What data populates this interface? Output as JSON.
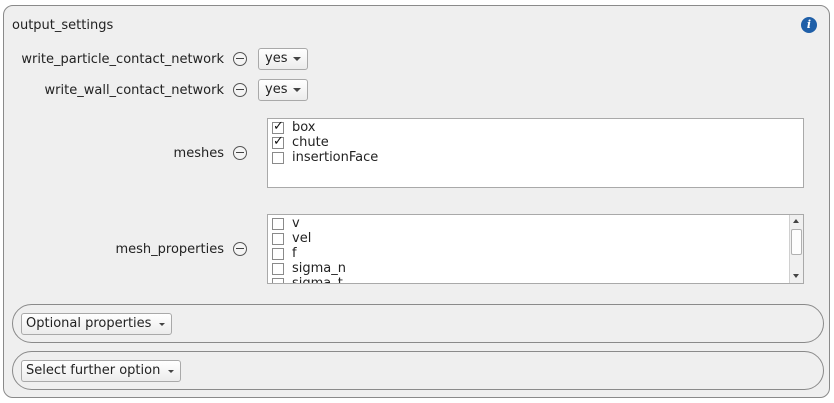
{
  "group": {
    "title": "output_settings",
    "info_icon": "info-icon"
  },
  "rows": [
    {
      "label": "write_particle_contact_network",
      "value": "yes"
    },
    {
      "label": "write_wall_contact_network",
      "value": "yes"
    }
  ],
  "meshes": {
    "label": "meshes",
    "items": [
      {
        "label": "box",
        "checked": true
      },
      {
        "label": "chute",
        "checked": true
      },
      {
        "label": "insertionFace",
        "checked": false
      }
    ]
  },
  "mesh_properties": {
    "label": "mesh_properties",
    "items": [
      {
        "label": "v",
        "checked": false
      },
      {
        "label": "vel",
        "checked": false
      },
      {
        "label": "f",
        "checked": false
      },
      {
        "label": "sigma_n",
        "checked": false
      },
      {
        "label": "sigma_t",
        "checked": false
      }
    ]
  },
  "optional_properties": {
    "label": "Optional properties"
  },
  "further_option": {
    "label": "Select further option"
  }
}
